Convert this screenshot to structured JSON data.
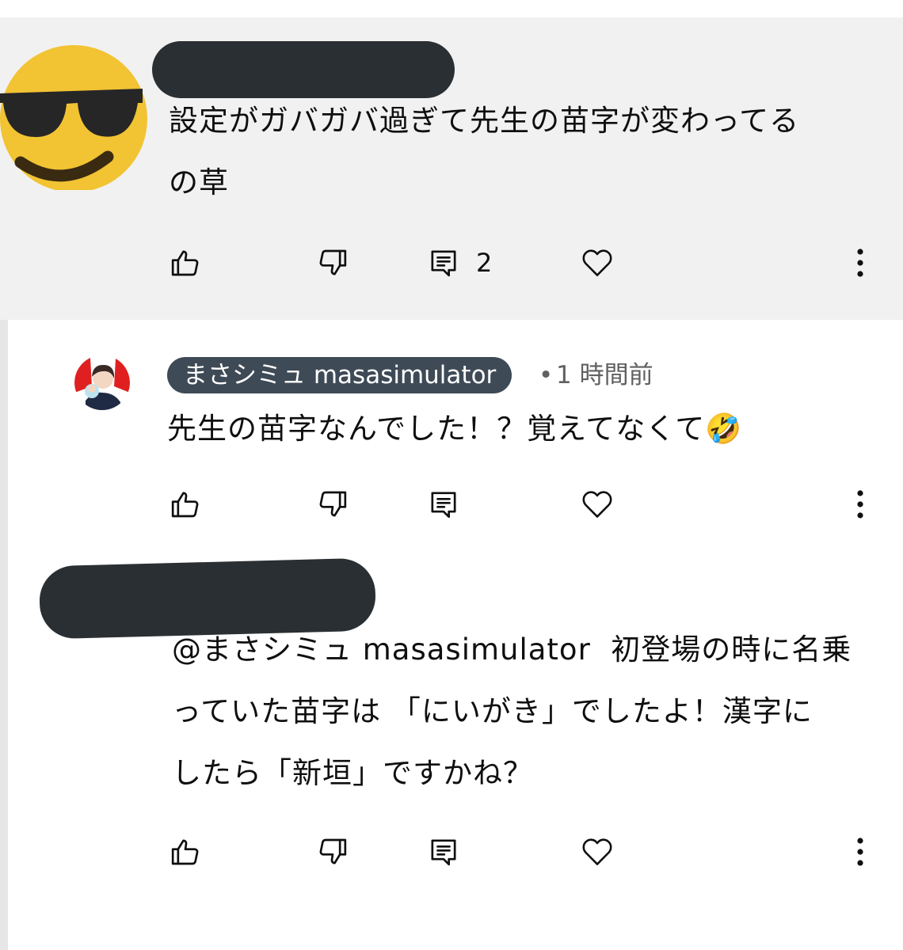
{
  "comments": [
    {
      "author_redacted": true,
      "avatar_icon": "sunglasses-emoji-icon",
      "text_lines": [
        "設定がガバガバ過ぎて先生の苗字が変わってる",
        "の草"
      ],
      "reply_count": "2"
    },
    {
      "author": "まさシミュ masasimulator",
      "separator": "•",
      "time_ago": "1 時間前",
      "avatar_icon": "channel-avatar-icon",
      "text": "先生の苗字なんでした！？覚えてなくて🤣"
    },
    {
      "author_redacted": true,
      "text_lines": [
        "@まさシミュ masasimulator  初登場の時に名乗",
        "っていた苗字は 「にいがき」でしたよ！漢字に",
        "したら「新垣」ですかね？"
      ]
    }
  ],
  "icons": {
    "like": "thumbs-up-icon",
    "dislike": "thumbs-down-icon",
    "reply": "reply-icon",
    "heart": "heart-icon",
    "more": "more-vertical-icon"
  },
  "colors": {
    "highlight_bg": "#f1f1f1",
    "owner_badge_bg": "#3e4a56",
    "redaction": "#2a2f33",
    "emoji_yellow": "#f2c332"
  }
}
